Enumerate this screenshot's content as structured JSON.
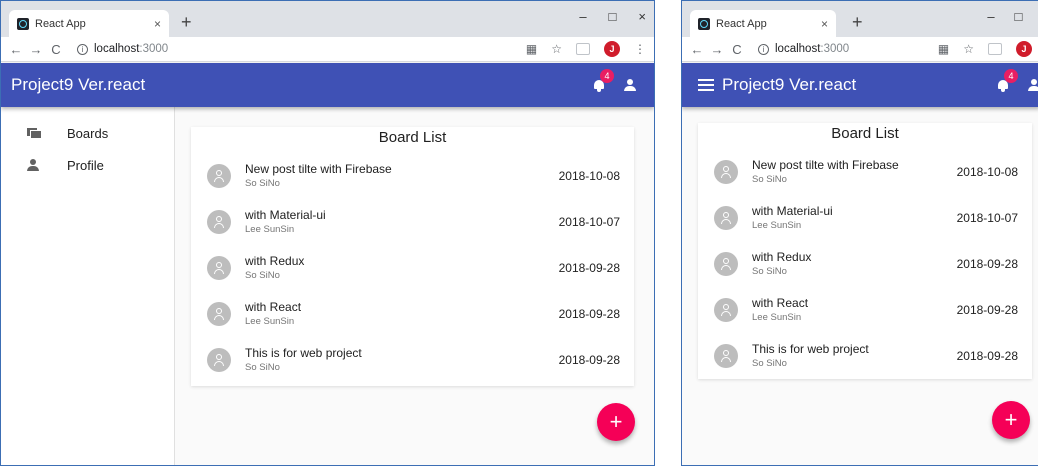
{
  "browser": {
    "tab_title": "React App",
    "tab_close": "×",
    "new_tab": "+",
    "minimize": "–",
    "maximize": "□",
    "close": "×",
    "back": "←",
    "forward": "→",
    "reload": "C",
    "info": "i",
    "url_host": "localhost",
    "url_port": ":3000",
    "translate": "▦",
    "star": "☆",
    "profile_initial": "J",
    "more": "⋮"
  },
  "app": {
    "title": "Project9 Ver.react",
    "primary_color": "#3f51b5",
    "accent_color": "#f50057",
    "notification_count": "4"
  },
  "drawer": {
    "items": [
      {
        "label": "Boards",
        "icon": "forum-icon"
      },
      {
        "label": "Profile",
        "icon": "person-icon"
      }
    ]
  },
  "board": {
    "title": "Board List",
    "posts": [
      {
        "title": "New post tilte with Firebase",
        "author": "So SiNo",
        "date": "2018-10-08"
      },
      {
        "title": "with Material-ui",
        "author": "Lee SunSin",
        "date": "2018-10-07"
      },
      {
        "title": "with Redux",
        "author": "So SiNo",
        "date": "2018-09-28"
      },
      {
        "title": "with React",
        "author": "Lee SunSin",
        "date": "2018-09-28"
      },
      {
        "title": "This is for web project",
        "author": "So SiNo",
        "date": "2018-09-28"
      }
    ]
  },
  "fab": {
    "label": "+"
  }
}
